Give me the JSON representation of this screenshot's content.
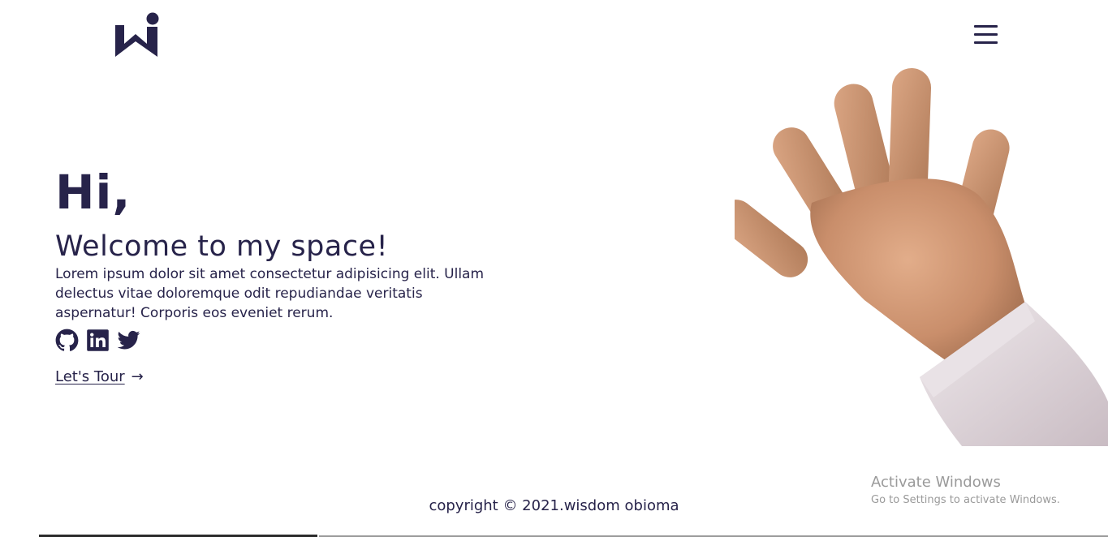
{
  "header": {
    "logo_icon": "wi-logo-icon",
    "menu_icon": "hamburger-menu-icon"
  },
  "hero": {
    "greeting": "Hi,",
    "welcome": "Welcome to my space!",
    "intro": "Lorem ipsum dolor sit amet consectetur adipisicing elit. Ullam delectus vitae doloremque odit repudiandae veritatis aspernatur! Corporis eos eveniet rerum.",
    "social_icons": [
      "github-icon",
      "linkedin-icon",
      "twitter-icon"
    ],
    "tour_label": "Let's Tour",
    "tour_arrow": "→"
  },
  "footer": {
    "copyright": "copyright © 2021.wisdom obioma"
  },
  "watermark": {
    "title": "Activate Windows",
    "subtitle": "Go to Settings to activate Windows."
  },
  "colors": {
    "primary": "#27234a",
    "background": "#ffffff",
    "watermark": "#9a9a9a"
  }
}
